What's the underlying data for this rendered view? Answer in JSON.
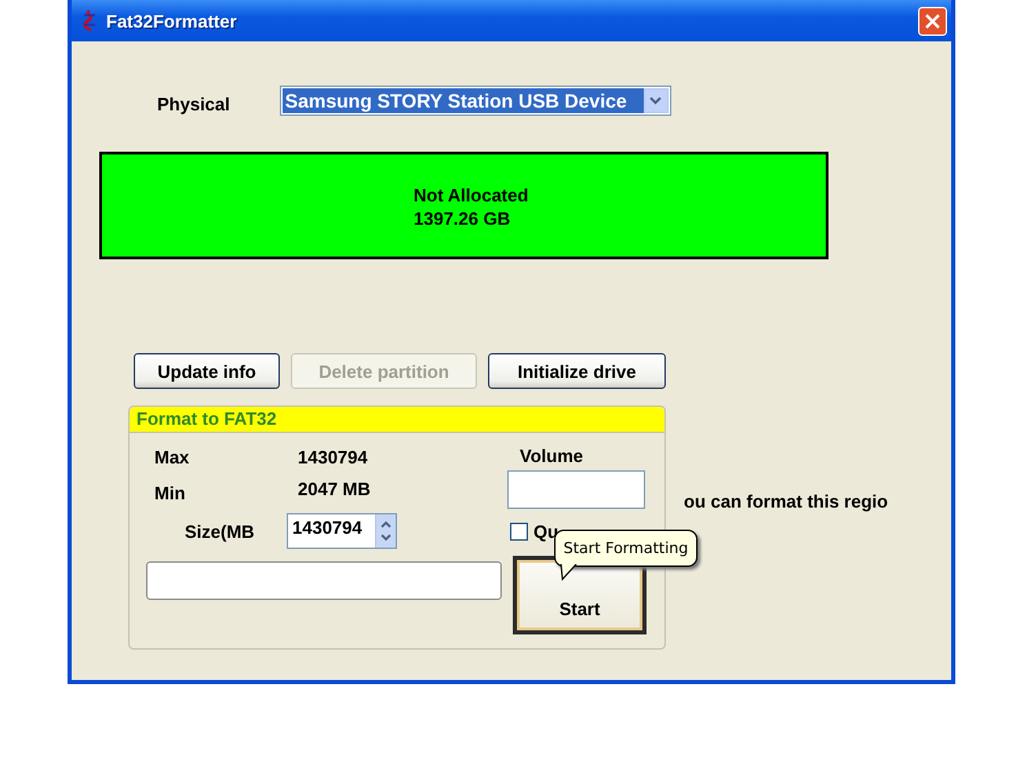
{
  "window": {
    "title": "Fat32Formatter"
  },
  "physical": {
    "label": "Physical",
    "value": "Samsung STORY Station USB Device",
    "selected": true
  },
  "partition_map": {
    "lines": [
      "Not Allocated",
      "1397.26 GB"
    ]
  },
  "buttons": [
    {
      "label": "Update info",
      "disabled": false
    },
    {
      "label": "Delete partition",
      "disabled": true
    },
    {
      "label": "Initialize drive",
      "disabled": false
    }
  ],
  "format_group": {
    "title": "Format to FAT32",
    "max_label": "Max",
    "max_value": "1430794",
    "min_label": "Min",
    "min_value": "2047 MB",
    "size_label": "Size(MB",
    "size_value": "1430794",
    "volume_label": "Volume",
    "quick_format": {
      "label": "Qu",
      "checked": false
    },
    "progress": {
      "level": 0
    },
    "start_button": "Start",
    "tooltip": "Start Formatting"
  },
  "region_message": "ou can format this regio"
}
